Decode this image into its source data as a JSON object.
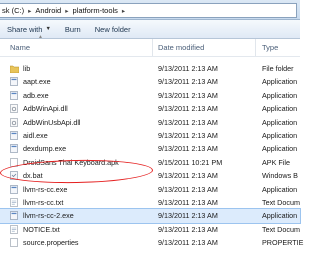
{
  "breadcrumb": {
    "items": [
      "sk (C:)",
      "Android",
      "platform-tools"
    ]
  },
  "toolbar": {
    "share_label": "Share with",
    "burn_label": "Burn",
    "new_folder_label": "New folder"
  },
  "columns": {
    "name": "Name",
    "date_modified": "Date modified",
    "type": "Type"
  },
  "files": [
    {
      "name": "lib",
      "date": "9/13/2011 2:13 AM",
      "type": "File folder",
      "icon": "folder-icon"
    },
    {
      "name": "aapt.exe",
      "date": "9/13/2011 2:13 AM",
      "type": "Application",
      "icon": "exe-icon"
    },
    {
      "name": "adb.exe",
      "date": "9/13/2011 2:13 AM",
      "type": "Application",
      "icon": "exe-icon"
    },
    {
      "name": "AdbWinApi.dll",
      "date": "9/13/2011 2:13 AM",
      "type": "Application",
      "icon": "dll-icon"
    },
    {
      "name": "AdbWinUsbApi.dll",
      "date": "9/13/2011 2:13 AM",
      "type": "Application",
      "icon": "dll-icon"
    },
    {
      "name": "aidl.exe",
      "date": "9/13/2011 2:13 AM",
      "type": "Application",
      "icon": "exe-icon"
    },
    {
      "name": "dexdump.exe",
      "date": "9/13/2011 2:13 AM",
      "type": "Application",
      "icon": "exe-icon"
    },
    {
      "name": "DroidSans Thai Keyboard.apk",
      "date": "9/15/2011 10:21 PM",
      "type": "APK File",
      "icon": "apk-icon"
    },
    {
      "name": "dx.bat",
      "date": "9/13/2011 2:13 AM",
      "type": "Windows B",
      "icon": "bat-icon"
    },
    {
      "name": "llvm-rs-cc.exe",
      "date": "9/13/2011 2:13 AM",
      "type": "Application",
      "icon": "exe-icon"
    },
    {
      "name": "llvm-rs-cc.txt",
      "date": "9/13/2011 2:13 AM",
      "type": "Text Docum",
      "icon": "txt-icon"
    },
    {
      "name": "llvm-rs-cc-2.exe",
      "date": "9/13/2011 2:13 AM",
      "type": "Application",
      "icon": "exe-icon",
      "selected": true
    },
    {
      "name": "NOTICE.txt",
      "date": "9/13/2011 2:13 AM",
      "type": "Text Docum",
      "icon": "txt-icon"
    },
    {
      "name": "source.properties",
      "date": "9/13/2011 2:13 AM",
      "type": "PROPERTIE",
      "icon": "properties-icon"
    }
  ]
}
